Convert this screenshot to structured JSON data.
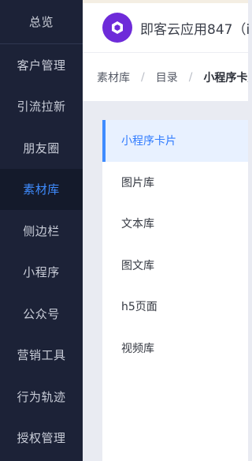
{
  "sidebar": {
    "items": [
      {
        "label": "总览"
      },
      {
        "label": "客户管理"
      },
      {
        "label": "引流拉新"
      },
      {
        "label": "朋友圈"
      },
      {
        "label": "素材库"
      },
      {
        "label": "侧边栏"
      },
      {
        "label": "小程序"
      },
      {
        "label": "公众号"
      },
      {
        "label": "营销工具"
      },
      {
        "label": "行为轨迹"
      },
      {
        "label": "授权管理"
      }
    ],
    "active_index": 4,
    "active_color": "#3f8cff"
  },
  "header": {
    "app_name": "即客云应用847（i",
    "logo_icon": "app-logo-icon"
  },
  "breadcrumb": {
    "items": [
      "素材库",
      "目录",
      "小程序卡片"
    ],
    "separator": "/"
  },
  "library": {
    "items": [
      {
        "label": "小程序卡片"
      },
      {
        "label": "图片库"
      },
      {
        "label": "文本库"
      },
      {
        "label": "图文库"
      },
      {
        "label": "h5页面"
      },
      {
        "label": "视频库"
      }
    ],
    "active_index": 0
  }
}
